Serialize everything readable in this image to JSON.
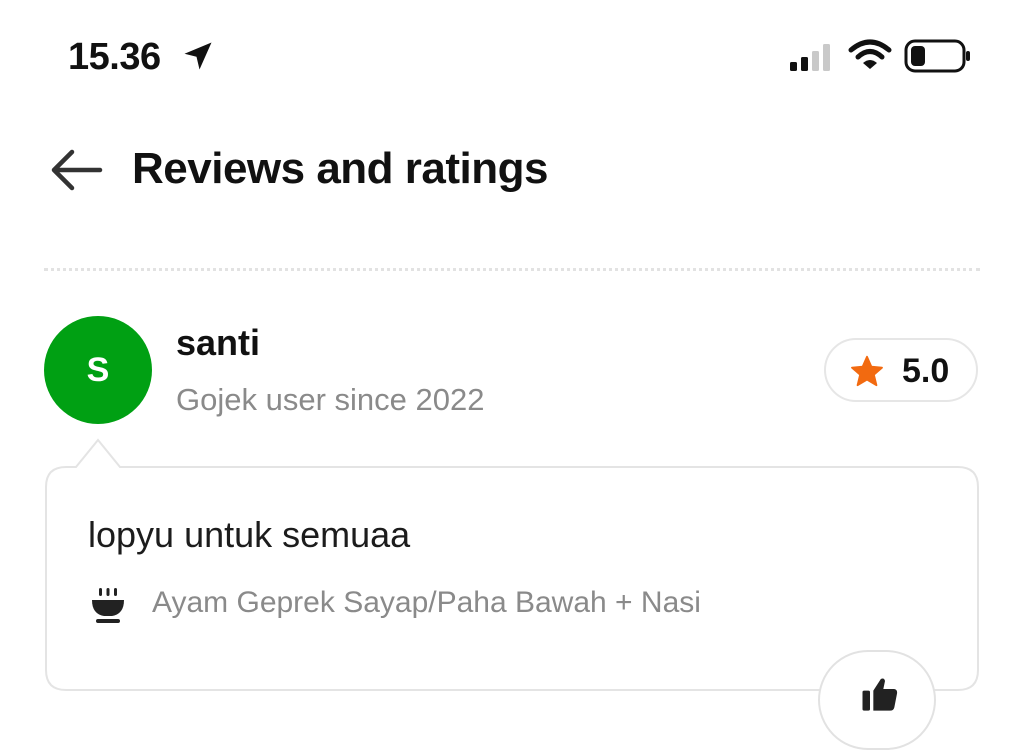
{
  "status": {
    "time": "15.36"
  },
  "header": {
    "title": "Reviews and ratings"
  },
  "review": {
    "avatar_initial": "S",
    "username": "santi",
    "user_since": "Gojek user since 2022",
    "rating": "5.0",
    "text": "lopyu untuk semuaa",
    "dish": "Ayam Geprek Sayap/Paha Bawah + Nasi"
  },
  "colors": {
    "avatar": "#00a013",
    "star": "#f26a10"
  },
  "icons": [
    "location-arrow-icon",
    "signal-icon",
    "wifi-icon",
    "battery-icon",
    "back-arrow-icon",
    "star-icon",
    "dish-icon",
    "thumbs-up-icon"
  ]
}
